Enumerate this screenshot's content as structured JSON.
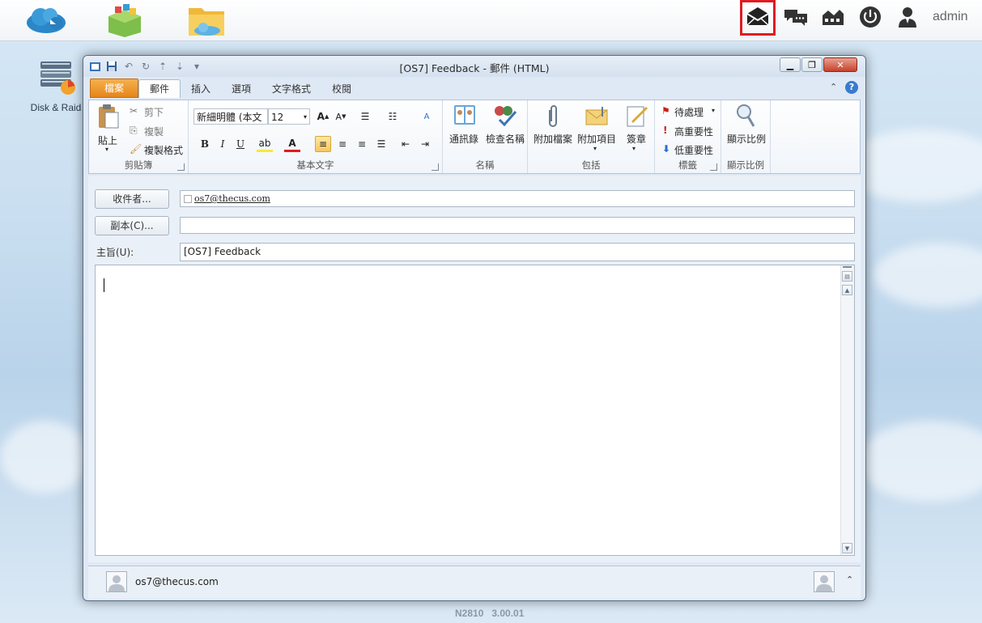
{
  "desktop": {
    "icons": [
      {
        "label": "Disk & Raid"
      }
    ],
    "footer_version": "N2810   3.00.01"
  },
  "topbar": {
    "user": "admin",
    "highlight_color": "#e01b22"
  },
  "window": {
    "title": "[OS7] Feedback - 郵件 (HTML)",
    "tabs": [
      "檔案",
      "郵件",
      "插入",
      "選項",
      "文字格式",
      "校閱"
    ],
    "active_tab": "郵件"
  },
  "ribbon": {
    "clipboard": {
      "paste": "貼上",
      "cut": "剪下",
      "copy": "複製",
      "format_painter": "複製格式",
      "label": "剪貼簿"
    },
    "basic_text": {
      "font_name": "新細明體 (本文",
      "font_size": "12",
      "bold": "B",
      "italic": "I",
      "underline": "U",
      "label": "基本文字"
    },
    "names": {
      "address_book": "通訊錄",
      "check_names": "檢查名稱",
      "label": "名稱"
    },
    "include": {
      "attach_file": "附加檔案",
      "attach_item": "附加項目",
      "signature": "簽章",
      "label": "包括"
    },
    "tags": {
      "follow_up": "待處理",
      "high_importance": "高重要性",
      "low_importance": "低重要性",
      "label": "標籤"
    },
    "zoom": {
      "zoom": "顯示比例",
      "label": "顯示比例"
    }
  },
  "form": {
    "to_button": "收件者...",
    "to_value": "os7@thecus.com",
    "cc_button": "副本(C)...",
    "cc_value": "",
    "subject_label": "主旨(U):",
    "subject_value": "[OS7] Feedback"
  },
  "people_pane": {
    "sender": "os7@thecus.com"
  }
}
